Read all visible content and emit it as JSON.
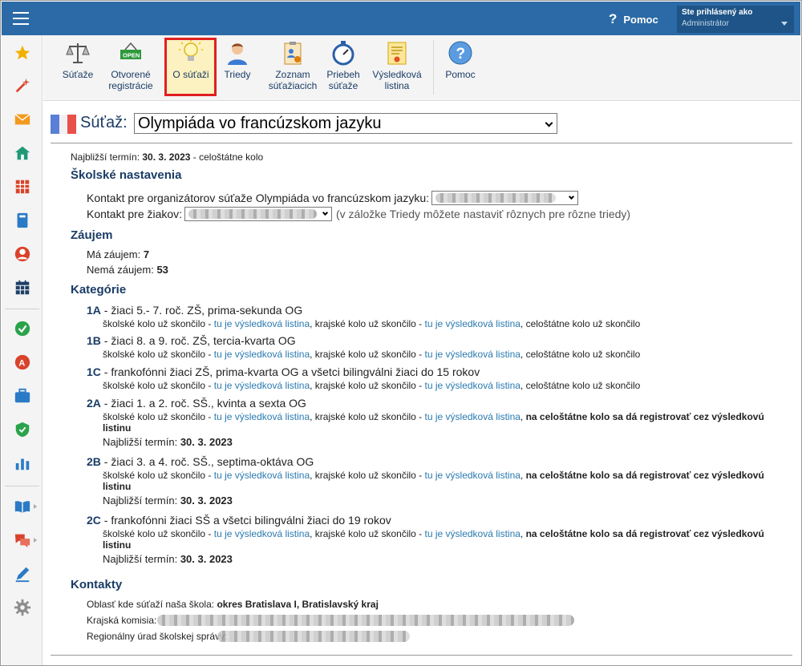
{
  "topbar": {
    "help_label": "Pomoc",
    "help_glyph": "?",
    "user_caption": "Ste prihlásený ako",
    "user_name": "Administrátor"
  },
  "sidebar": {
    "icons": [
      "star-icon",
      "magic-wand-icon",
      "envelope-icon",
      "home-icon",
      "calendar-grid-icon",
      "book-icon",
      "user-circle-icon",
      "timetable-icon",
      "checkmark-icon",
      "grade-icon",
      "briefcase-icon",
      "shield-icon",
      "bar-chart-icon",
      "open-book-icon",
      "chat-icon",
      "pencil-icon",
      "gear-icon"
    ]
  },
  "toolbar": {
    "items": [
      {
        "label": "Súťaže",
        "icon": "scales-icon"
      },
      {
        "label": "Otvorené\nregistrácie",
        "icon": "open-sign-icon",
        "sign_text": "OPEN"
      },
      {
        "label": "O súťaži",
        "icon": "lightbulb-icon"
      },
      {
        "label": "Triedy",
        "icon": "person-icon"
      },
      {
        "label": "Zoznam\nsúťažiacich",
        "icon": "clipboard-icon"
      },
      {
        "label": "Priebeh\nsúťaže",
        "icon": "stopwatch-icon"
      },
      {
        "label": "Výsledková\nlistina",
        "icon": "certificate-icon"
      },
      {
        "label": "Pomoc",
        "icon": "help-icon",
        "glyph": "?"
      }
    ]
  },
  "header": {
    "label": "Súťaž:",
    "selected": "Olympiáda vo francúzskom jazyku"
  },
  "main": {
    "next_date_label": "Najbližší termín:",
    "next_date_value": "30. 3. 2023",
    "next_date_suffix": "- celoštátne kolo",
    "school_settings": {
      "heading": "Školské nastavenia",
      "contact_org_label": "Kontakt pre organizátorov súťaže Olympiáda vo francúzskom jazyku:",
      "contact_students_label": "Kontakt pre žiakov:",
      "contact_students_note": "(v záložke Triedy môžete nastaviť rôznych pre rôzne triedy)"
    },
    "interest": {
      "heading": "Záujem",
      "has_label": "Má záujem:",
      "has_value": "7",
      "none_label": "Nemá záujem:",
      "none_value": "53"
    },
    "categories": {
      "heading": "Kategórie",
      "school_done": "školské kolo už skončilo -",
      "region_done": "krajské kolo už skončilo -",
      "link": "tu je výsledková listina",
      "national_done": "celoštátne kolo už skončilo",
      "national_reg": "na celoštátne kolo sa dá registrovať cez výsledkovú",
      "national_reg_2": "listinu",
      "date_label": "Najbližší termín:",
      "date_value": "30. 3. 2023",
      "items": [
        {
          "code": "1A",
          "desc": "- žiaci 5.- 7. roč. ZŠ, prima-sekunda OG"
        },
        {
          "code": "1B",
          "desc": "- žiaci 8. a 9. roč. ZŠ, tercia-kvarta OG"
        },
        {
          "code": "1C",
          "desc": "- frankofónni žiaci ZŠ, prima-kvarta OG a všetci bilingválni žiaci do 15 rokov"
        },
        {
          "code": "2A",
          "desc": "- žiaci 1. a 2. roč. SŠ., kvinta a sexta OG"
        },
        {
          "code": "2B",
          "desc": "- žiaci 3. a 4. roč. SŠ., septima-oktáva OG"
        },
        {
          "code": "2C",
          "desc": "- frankofónni žiaci SŠ a všetci bilingválni žiaci do 19 rokov"
        }
      ]
    },
    "contacts": {
      "heading": "Kontakty",
      "area_label": "Oblasť kde súťaží naša škola:",
      "area_value": "okres Bratislava I, Bratislavský kraj",
      "commission_label": "Krajská komisia:",
      "office_label": "Regionálny úrad školskej správy:"
    }
  },
  "colors": {
    "topbar": "#2b6aa6",
    "active_border": "#e02020",
    "active_bg": "#fcf1c0",
    "link": "#2a7ab0",
    "heading": "#1a3c66"
  }
}
